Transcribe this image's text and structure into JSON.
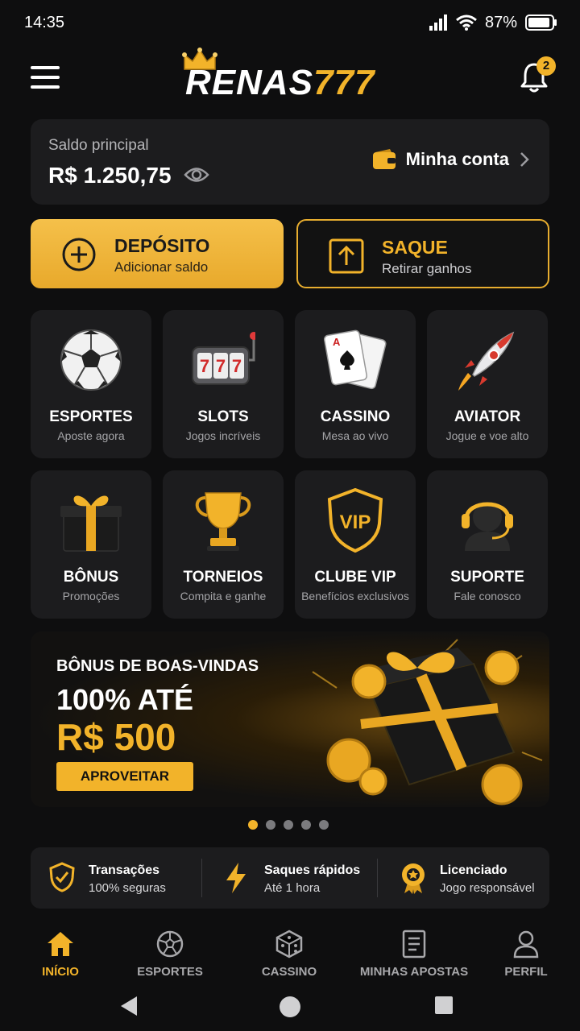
{
  "status": {
    "time": "14:35",
    "battery": "87%"
  },
  "header": {
    "logo_white": "RENAS",
    "logo_gold": "777",
    "notifications_count": "2",
    "icons": [
      "menu-icon",
      "crown-icon",
      "bell-icon"
    ]
  },
  "balance": {
    "label": "Saldo principal",
    "value": "R$ 1.250,75",
    "account_link": "Minha conta"
  },
  "actions": {
    "deposit_title": "DEPÓSITO",
    "deposit_sub": "Adicionar saldo",
    "withdraw_title": "SAQUE",
    "withdraw_sub": "Retirar ganhos"
  },
  "categories": [
    {
      "title": "ESPORTES",
      "sub": "Aposte agora",
      "icon": "soccer-ball-icon"
    },
    {
      "title": "SLOTS",
      "sub": "Jogos incríveis",
      "icon": "slot-machine-icon"
    },
    {
      "title": "CASSINO",
      "sub": "Mesa ao vivo",
      "icon": "playing-cards-icon"
    },
    {
      "title": "AVIATOR",
      "sub": "Jogue e voe alto",
      "icon": "rocket-icon"
    },
    {
      "title": "BÔNUS",
      "sub": "Promoções",
      "icon": "gift-icon"
    },
    {
      "title": "TORNEIOS",
      "sub": "Compita e ganhe",
      "icon": "trophy-icon"
    },
    {
      "title": "CLUBE VIP",
      "sub": "Benefícios exclusivos",
      "icon": "vip-shield-icon"
    },
    {
      "title": "SUPORTE",
      "sub": "Fale conosco",
      "icon": "headset-icon"
    }
  ],
  "banner": {
    "kicker": "BÔNUS DE BOAS-VINDAS",
    "line1": "100% ATÉ",
    "line2": "R$ 500",
    "cta": "APROVEITAR",
    "slides": 5,
    "active_slide": 1
  },
  "trust": [
    {
      "title": "Transações",
      "sub": "100% seguras",
      "icon": "shield-check-icon"
    },
    {
      "title": "Saques rápidos",
      "sub": "Até 1 hora",
      "icon": "lightning-icon"
    },
    {
      "title": "Licenciado",
      "sub": "Jogo responsável",
      "icon": "medal-icon"
    }
  ],
  "nav": [
    {
      "label": "INÍCIO",
      "icon": "home-icon",
      "active": true
    },
    {
      "label": "ESPORTES",
      "icon": "soccer-ball-icon",
      "active": false
    },
    {
      "label": "CASSINO",
      "icon": "dice-icon",
      "active": false
    },
    {
      "label": "MINHAS APOSTAS",
      "icon": "betslip-icon",
      "active": false
    },
    {
      "label": "PERFIL",
      "icon": "user-icon",
      "active": false
    }
  ],
  "colors": {
    "accent": "#f2b32a",
    "background": "#0e0e0f",
    "card": "#1c1c1e"
  }
}
